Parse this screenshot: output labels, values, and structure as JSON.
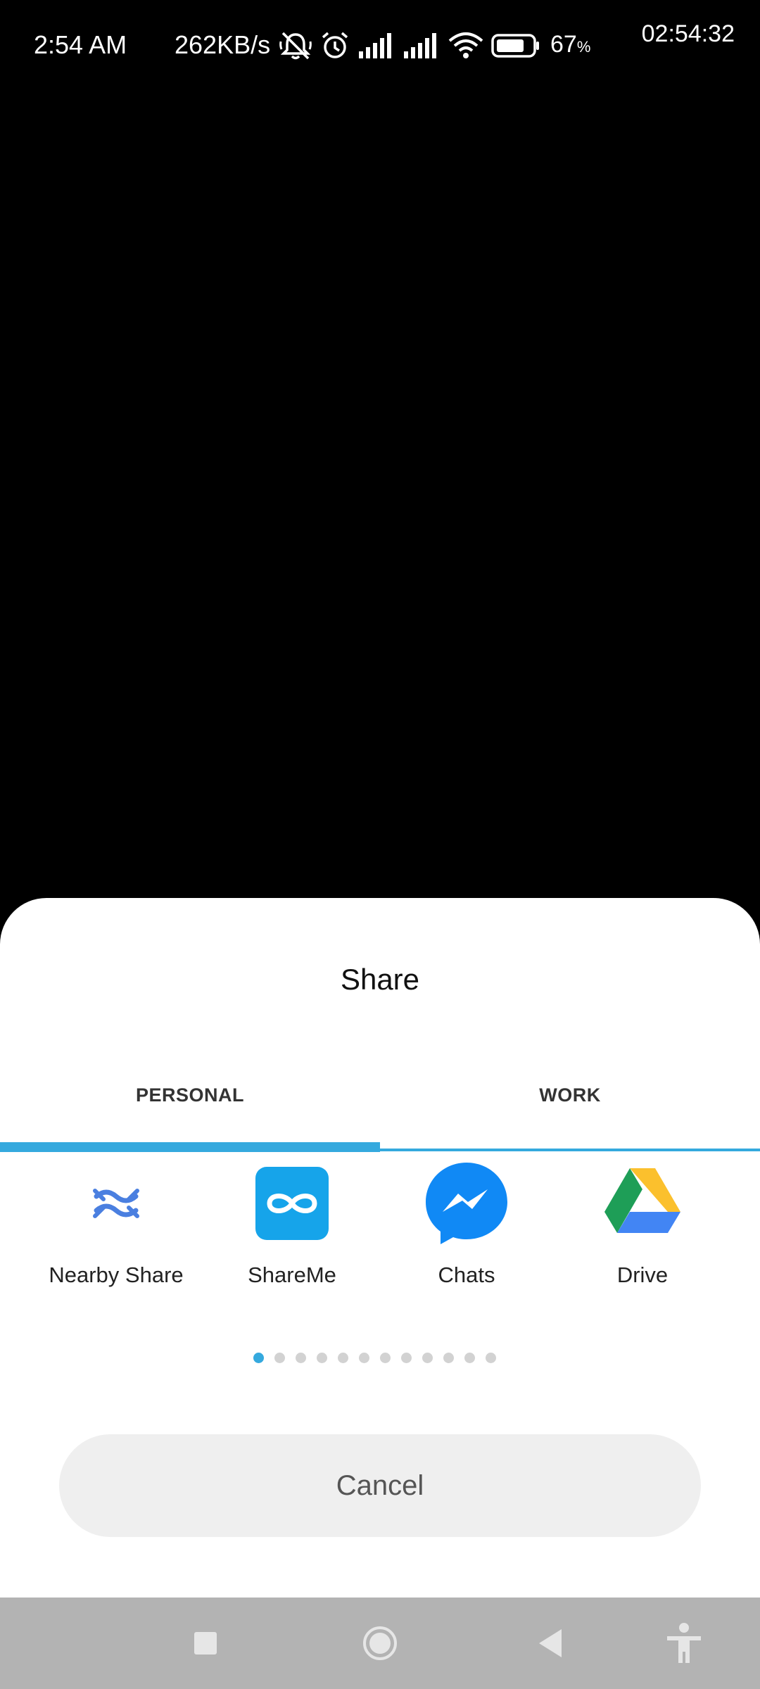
{
  "status_bar": {
    "time": "2:54 AM",
    "network_speed": "262KB/s",
    "battery_percent": "67",
    "battery_unit": "%",
    "clock_overlay": "02:54:32",
    "icons": [
      "mute-icon",
      "alarm-icon",
      "signal-icon",
      "signal-icon",
      "wifi-icon",
      "battery-icon"
    ]
  },
  "share_sheet": {
    "title": "Share",
    "tabs": [
      {
        "label": "PERSONAL",
        "selected": true
      },
      {
        "label": "WORK",
        "selected": false
      }
    ],
    "apps": [
      {
        "label": "Nearby Share",
        "icon": "nearby-share-icon"
      },
      {
        "label": "ShareMe",
        "icon": "shareme-icon"
      },
      {
        "label": "Chats",
        "icon": "messenger-icon"
      },
      {
        "label": "Drive",
        "icon": "drive-icon"
      }
    ],
    "page_count": 12,
    "current_page": 1,
    "cancel_label": "Cancel"
  },
  "colors": {
    "accent": "#35a9de",
    "sheet_bg": "#ffffff",
    "cancel_bg": "#efefef",
    "nav_bg": "#b3b3b3"
  },
  "nav_bar": {
    "buttons": [
      "recents-icon",
      "home-icon",
      "back-icon",
      "accessibility-icon"
    ]
  }
}
